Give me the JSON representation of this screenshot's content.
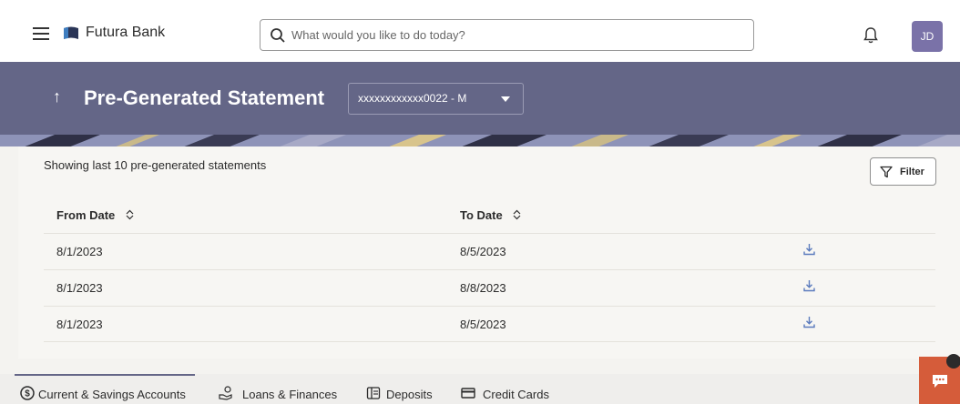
{
  "header": {
    "brand": "Futura Bank",
    "search_placeholder": "What would you like to do today?",
    "avatar_initials": "JD"
  },
  "title_band": {
    "title": "Pre-Generated Statement",
    "account_selected": "xxxxxxxxxxxx0022 - M"
  },
  "content": {
    "showing_text": "Showing last 10 pre-generated statements",
    "filter_label": "Filter",
    "columns": {
      "from": "From Date",
      "to": "To Date"
    },
    "rows": [
      {
        "from": "8/1/2023",
        "to": "8/5/2023"
      },
      {
        "from": "8/1/2023",
        "to": "8/8/2023"
      },
      {
        "from": "8/1/2023",
        "to": "8/5/2023"
      }
    ]
  },
  "tabs": [
    {
      "label": "Current & Savings Accounts",
      "icon": "dollar-circle-icon",
      "active": true
    },
    {
      "label": "Loans & Finances",
      "icon": "loan-hand-icon",
      "active": false
    },
    {
      "label": "Deposits",
      "icon": "deposits-icon",
      "active": false
    },
    {
      "label": "Credit Cards",
      "icon": "credit-card-icon",
      "active": false
    }
  ],
  "colors": {
    "band": "#646687",
    "avatar": "#7a72a8",
    "chat": "#d55c3a",
    "download": "#5b7bbd"
  }
}
